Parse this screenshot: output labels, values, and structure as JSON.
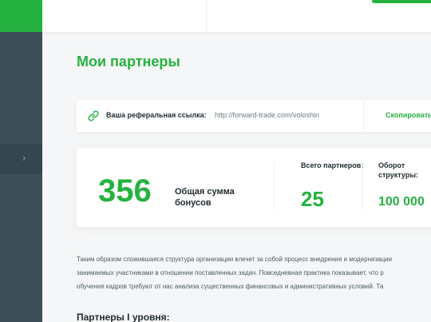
{
  "page": {
    "title": "Мои партнеры"
  },
  "referral": {
    "label": "Ваша реферальная ссылка:",
    "url": "http://forward-trade.com/voloshin",
    "copy_label": "Скопировать"
  },
  "stats": {
    "bonus_total": "356",
    "bonus_label": "Общая сумма бонусов",
    "partners_label": "Всего партнеров:",
    "partners_value": "25",
    "turnover_label": "Оборот структуры:",
    "turnover_value": "100 000"
  },
  "description": {
    "lines": [
      "Таким образом сложившаяся структура организации влечет за собой процесс внедрения и модернизации",
      "занимаемых участниками в отношении поставленных задач. Повседневная практика показывает, что р",
      "обучения кадров требуют от нас анализа существенных финансовых и административных условий. Та"
    ]
  },
  "partners_section": {
    "title": "Партнеры I уровня:"
  },
  "colors": {
    "accent": "#26b240",
    "sidebar": "#3c4f58"
  },
  "icons": {
    "link": "link-icon",
    "chevron": "chevron-right-icon"
  }
}
